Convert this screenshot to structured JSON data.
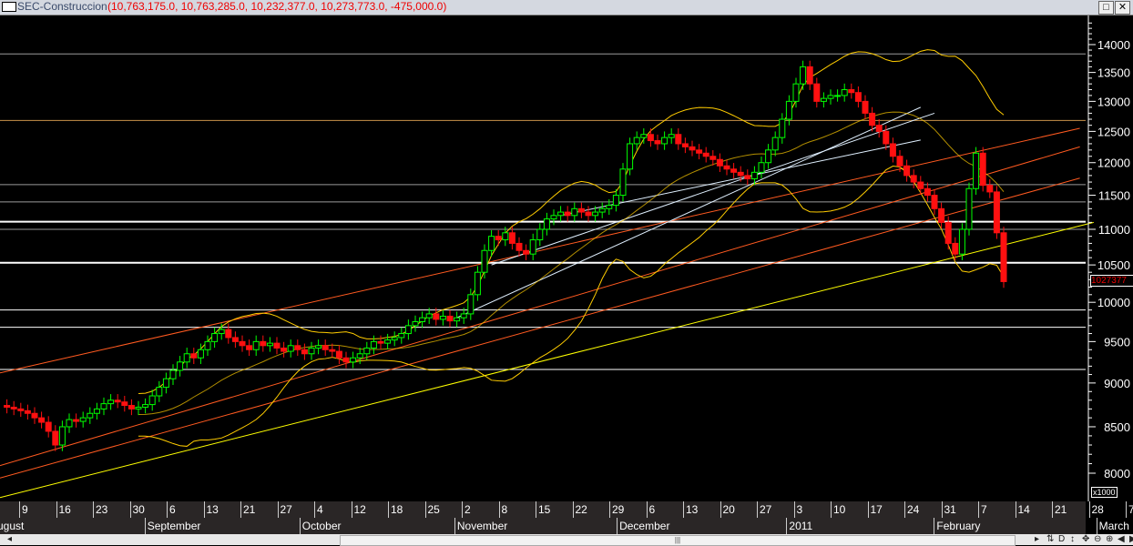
{
  "window": {
    "title": "SEC-Construccion",
    "ohlc": "(10,763,175.0, 10,763,285.0, 10,232,377.0, 10,273,773.0, -475,000.0)",
    "maximize": "□",
    "close": "✕"
  },
  "scale_note": "x1000",
  "last_price_label": "1027377",
  "scrollbar": {
    "left_arrow": "◂",
    "thumb": "|||",
    "tools": [
      "▸",
      "⇅",
      "D",
      "↕",
      "✥",
      "⊖",
      "⊕",
      "◀",
      "▶"
    ]
  },
  "chart_data": {
    "type": "candlestick",
    "title": "SEC-Construccion",
    "yscale": "log",
    "ylim": [
      7700,
      14400
    ],
    "yticks": [
      8000,
      8500,
      9000,
      9500,
      10000,
      10500,
      11000,
      11500,
      12000,
      12500,
      13000,
      13500,
      14000
    ],
    "xticks": [
      {
        "label": "9",
        "day": 5
      },
      {
        "label": "16",
        "day": 10
      },
      {
        "label": "23",
        "day": 15
      },
      {
        "label": "30",
        "day": 20
      },
      {
        "label": "6",
        "day": 25
      },
      {
        "label": "13",
        "day": 30
      },
      {
        "label": "21",
        "day": 35
      },
      {
        "label": "27",
        "day": 40
      },
      {
        "label": "4",
        "day": 45
      },
      {
        "label": "12",
        "day": 50
      },
      {
        "label": "18",
        "day": 55
      },
      {
        "label": "25",
        "day": 60
      },
      {
        "label": "2",
        "day": 65
      },
      {
        "label": "8",
        "day": 70
      },
      {
        "label": "15",
        "day": 75
      },
      {
        "label": "22",
        "day": 80
      },
      {
        "label": "29",
        "day": 85
      },
      {
        "label": "6",
        "day": 90
      },
      {
        "label": "13",
        "day": 95
      },
      {
        "label": "20",
        "day": 100
      },
      {
        "label": "27",
        "day": 105
      },
      {
        "label": "3",
        "day": 110
      },
      {
        "label": "10",
        "day": 115
      },
      {
        "label": "17",
        "day": 120
      },
      {
        "label": "24",
        "day": 125
      },
      {
        "label": "31",
        "day": 130
      },
      {
        "label": "7",
        "day": 135
      },
      {
        "label": "14",
        "day": 140
      },
      {
        "label": "21",
        "day": 145
      },
      {
        "label": "28",
        "day": 150
      },
      {
        "label": "7",
        "day": 155
      }
    ],
    "months": [
      {
        "label": "August",
        "day": -8
      },
      {
        "label": "September",
        "day": 22
      },
      {
        "label": "October",
        "day": 43
      },
      {
        "label": "November",
        "day": 64
      },
      {
        "label": "December",
        "day": 86
      },
      {
        "label": "2011",
        "day": 109
      },
      {
        "label": "February",
        "day": 129
      },
      {
        "label": "March",
        "day": 151
      }
    ],
    "closes": [
      8720,
      8700,
      8680,
      8650,
      8600,
      8550,
      8450,
      8300,
      8500,
      8580,
      8560,
      8600,
      8650,
      8700,
      8760,
      8800,
      8780,
      8740,
      8700,
      8720,
      8750,
      8850,
      8950,
      9050,
      9150,
      9250,
      9350,
      9300,
      9400,
      9500,
      9600,
      9650,
      9550,
      9500,
      9450,
      9400,
      9500,
      9450,
      9480,
      9420,
      9380,
      9450,
      9400,
      9350,
      9420,
      9450,
      9400,
      9380,
      9300,
      9250,
      9300,
      9350,
      9420,
      9500,
      9480,
      9520,
      9550,
      9600,
      9700,
      9750,
      9800,
      9850,
      9780,
      9820,
      9760,
      9800,
      9850,
      10100,
      10400,
      10700,
      10900,
      10850,
      10950,
      10800,
      10700,
      10650,
      10850,
      11000,
      11150,
      11200,
      11250,
      11200,
      11300,
      11250,
      11200,
      11250,
      11300,
      11350,
      11500,
      11900,
      12300,
      12400,
      12450,
      12350,
      12300,
      12400,
      12450,
      12300,
      12250,
      12200,
      12150,
      12100,
      12050,
      11950,
      11900,
      11850,
      11800,
      11750,
      11850,
      12000,
      12200,
      12400,
      12700,
      13000,
      13300,
      13600,
      13300,
      13000,
      13050,
      13100,
      13100,
      13200,
      13150,
      13000,
      12800,
      12600,
      12500,
      12300,
      12100,
      11950,
      11800,
      11700,
      11600,
      11500,
      11300,
      11100,
      10800,
      10650,
      11000,
      11600,
      12150,
      11650,
      11550,
      10950,
      10274
    ],
    "horizontal_levels": [
      {
        "value": 13830,
        "color": "#9a9a9a"
      },
      {
        "value": 12680,
        "color": "#c8924a"
      },
      {
        "value": 11660,
        "color": "#9a9a9a"
      },
      {
        "value": 11400,
        "color": "#9a9a9a"
      },
      {
        "value": 11110,
        "color": "#ffffff",
        "width": 2
      },
      {
        "value": 11000,
        "color": "#9a9a9a"
      },
      {
        "value": 10530,
        "color": "#ffffff",
        "width": 2
      },
      {
        "value": 9900,
        "color": "#ffffff"
      },
      {
        "value": 9680,
        "color": "#ffffff"
      },
      {
        "value": 9160,
        "color": "#ffffff"
      }
    ],
    "colors": {
      "up": "#00ff00",
      "down": "#ff1010",
      "bands": "#ffcc00",
      "support": "#ffff00",
      "channel": "#ff5a20",
      "trend": "#e0f0ff"
    }
  }
}
